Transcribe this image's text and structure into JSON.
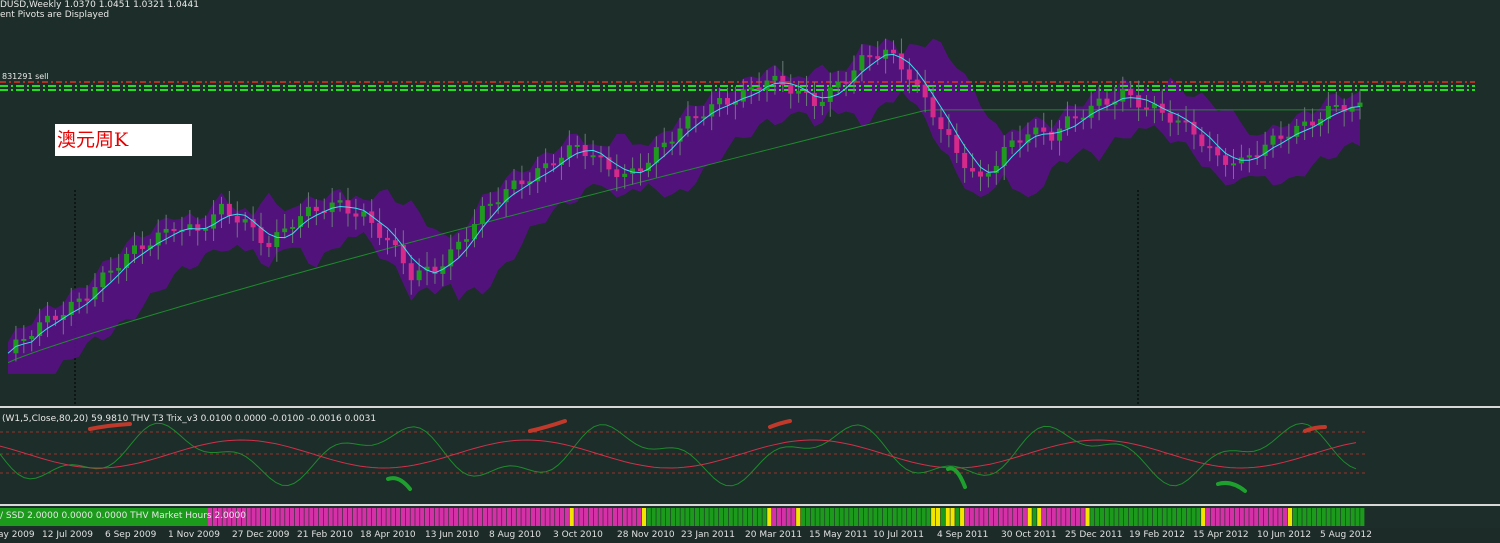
{
  "main_chart": {
    "symbol_line": "DUSD,Weekly  1.0370 1.0451 1.0321 1.0441",
    "pivots_line": "ent Pivots are Displayed",
    "level_label": "831291 sell",
    "annotation": "澳元周K"
  },
  "indicator1": {
    "header": "(W1,5,Close,80,20) 59.9810    THV T3 Trix_v3   0.0100 0.0000 -0.0100 -0.0016 0.0031"
  },
  "indicator2": {
    "header": "/ SSD 2.0000 0.0000 0.0000   THV Market Hours 2.0000"
  },
  "time_axis": {
    "labels": [
      "ay 2009",
      "12 Jul 2009",
      "6 Sep 2009",
      "1 Nov 2009",
      "27 Dec 2009",
      "21 Feb 2010",
      "18 Apr 2010",
      "13 Jun 2010",
      "8 Aug 2010",
      "3 Oct 2010",
      "28 Nov 2010",
      "23 Jan 2011",
      "20 Mar 2011",
      "15 May 2011",
      "10 Jul 2011",
      "4 Sep 2011",
      "30 Oct 2011",
      "25 Dec 2011",
      "19 Feb 2012",
      "15 Apr 2012",
      "10 Jun 2012",
      "5 Aug 2012"
    ]
  },
  "colors": {
    "background": "#1d2d29",
    "bull_candle": "#1f9a1f",
    "bear_candle": "#d62a8a",
    "cloud": "#5a0f8a",
    "fast_ma": "#38e0e8",
    "slow_ma": "#1e8a2e",
    "pivot_green": "#22dd22",
    "pivot_red": "#dd3322",
    "market_hours_green": "#1b9a1b",
    "market_hours_magenta": "#d630a8",
    "market_hours_yellow": "#f2e600"
  },
  "chart_data": {
    "type": "candlestick",
    "title": "DUSD,Weekly",
    "ohlc_last": {
      "open": 1.037,
      "high": 1.0451,
      "low": 1.0321,
      "close": 1.0441
    },
    "close_series_approx": [
      0.78,
      0.8,
      0.82,
      0.84,
      0.86,
      0.88,
      0.9,
      0.92,
      0.91,
      0.93,
      0.92,
      0.9,
      0.92,
      0.93,
      0.94,
      0.93,
      0.9,
      0.86,
      0.87,
      0.9,
      0.93,
      0.95,
      0.97,
      0.99,
      1.0,
      0.98,
      0.97,
      0.99,
      1.01,
      1.03,
      1.05,
      1.06,
      1.07,
      1.06,
      1.05,
      1.07,
      1.09,
      1.1,
      1.08,
      1.04,
      0.99,
      0.96,
      1.0,
      1.02,
      1.01,
      1.03,
      1.05,
      1.06,
      1.04,
      1.03,
      1.02,
      0.99,
      0.98,
      1.0,
      1.02,
      1.03,
      1.04,
      1.04
    ],
    "x_labels": [
      "ay 2009",
      "12 Jul 2009",
      "6 Sep 2009",
      "1 Nov 2009",
      "27 Dec 2009",
      "21 Feb 2010",
      "18 Apr 2010",
      "13 Jun 2010",
      "8 Aug 2010",
      "3 Oct 2010",
      "28 Nov 2010",
      "23 Jan 2011",
      "20 Mar 2011",
      "15 May 2011",
      "10 Jul 2011",
      "4 Sep 2011",
      "30 Oct 2011",
      "25 Dec 2011",
      "19 Feb 2012",
      "15 Apr 2012",
      "10 Jun 2012",
      "5 Aug 2012"
    ]
  },
  "market_hours_blocks": [
    "m",
    "m",
    "m",
    "m",
    "m",
    "m",
    "m",
    "m",
    "m",
    "m",
    "m",
    "m",
    "m",
    "m",
    "m",
    "m",
    "m",
    "m",
    "m",
    "m",
    "m",
    "m",
    "m",
    "m",
    "m",
    "m",
    "m",
    "m",
    "m",
    "m",
    "m",
    "m",
    "m",
    "m",
    "m",
    "m",
    "m",
    "m",
    "m",
    "m",
    "m",
    "m",
    "m",
    "m",
    "m",
    "m",
    "m",
    "m",
    "m",
    "m",
    "m",
    "m",
    "m",
    "m",
    "m",
    "m",
    "m",
    "m",
    "m",
    "m",
    "m",
    "m",
    "m",
    "m",
    "m",
    "m",
    "m",
    "m",
    "m",
    "m",
    "m",
    "m",
    "m",
    "m",
    "m",
    "y",
    "m",
    "m",
    "m",
    "m",
    "m",
    "m",
    "m",
    "m",
    "m",
    "m",
    "m",
    "m",
    "m",
    "m",
    "y",
    "g",
    "g",
    "g",
    "g",
    "g",
    "g",
    "g",
    "g",
    "g",
    "g",
    "g",
    "g",
    "g",
    "g",
    "g",
    "g",
    "g",
    "g",
    "g",
    "g",
    "g",
    "g",
    "g",
    "g",
    "g",
    "y",
    "m",
    "m",
    "m",
    "m",
    "m",
    "y",
    "g",
    "g",
    "g",
    "g",
    "g",
    "g",
    "g",
    "g",
    "g",
    "g",
    "g",
    "g",
    "g",
    "g",
    "g",
    "g",
    "g",
    "g",
    "g",
    "g",
    "g",
    "g",
    "g",
    "g",
    "g",
    "g",
    "g",
    "y",
    "y",
    "g",
    "y",
    "y",
    "g",
    "y",
    "m",
    "m",
    "m",
    "m",
    "m",
    "m",
    "m",
    "m",
    "m",
    "m",
    "m",
    "m",
    "m",
    "y",
    "g",
    "y",
    "m",
    "m",
    "m",
    "m",
    "m",
    "m",
    "m",
    "m",
    "m",
    "y",
    "g",
    "g",
    "g",
    "g",
    "g",
    "g",
    "g",
    "g",
    "g",
    "g",
    "g",
    "g",
    "g",
    "g",
    "g",
    "g",
    "g",
    "g",
    "g",
    "g",
    "g",
    "g",
    "g",
    "y",
    "m",
    "m",
    "m",
    "m",
    "m",
    "m",
    "m",
    "m",
    "m",
    "m",
    "m",
    "m",
    "m",
    "m",
    "m",
    "m",
    "m",
    "y",
    "g",
    "g",
    "g",
    "g",
    "g",
    "g",
    "g",
    "g",
    "g",
    "g",
    "g",
    "g",
    "g",
    "g",
    "g"
  ]
}
